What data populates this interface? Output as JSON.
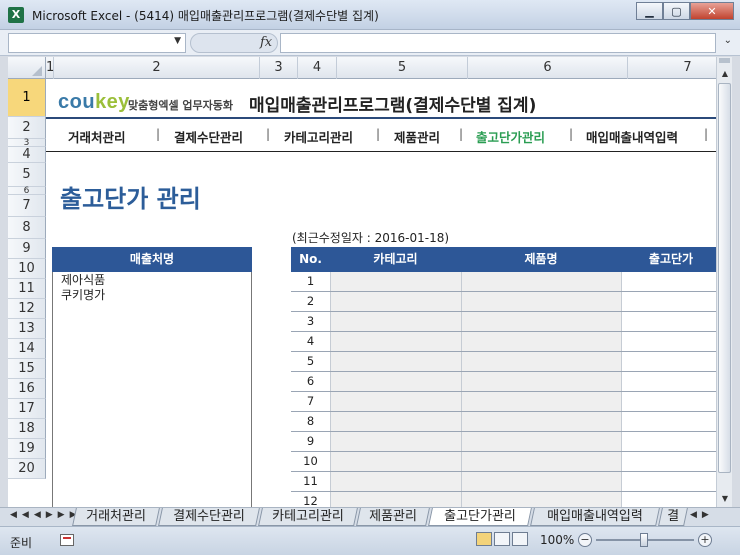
{
  "window": {
    "title": "Microsoft Excel - (5414) 매입매출관리프로그램(결제수단별 집계)",
    "app_icon": "X",
    "minimize": "▁",
    "maximize": "▢",
    "close": "✕"
  },
  "formula_bar": {
    "name_box": "",
    "fx_label": "fx",
    "formula": ""
  },
  "columns": [
    "1",
    "2",
    "3",
    "4",
    "5",
    "6",
    "7"
  ],
  "rows": [
    "1",
    "2",
    "3",
    "4",
    "5",
    "6",
    "7",
    "8",
    "9",
    "10",
    "11",
    "12",
    "13",
    "14",
    "15",
    "16",
    "17",
    "18",
    "19",
    "20"
  ],
  "header": {
    "brand": "cou",
    "brand_k": "key",
    "brand_sub": "맞춤형엑셀 업무자동화",
    "app_title": "매입매출관리프로그램(결제수단별 집계)"
  },
  "nav": {
    "items": [
      "거래처관리",
      "결제수단관리",
      "카테고리관리",
      "제품관리",
      "출고단가관리",
      "매입매출내역입력"
    ],
    "active_index": 4,
    "separator": "|"
  },
  "page": {
    "title": "출고단가 관리",
    "revision_date": "(최근수정일자 : 2016-01-18)"
  },
  "customer_panel": {
    "header": "매출처명",
    "items": [
      "제아식품",
      "쿠키명가"
    ]
  },
  "price_table": {
    "headers": [
      "No.",
      "카테고리",
      "제품명",
      "출고단가"
    ],
    "rows": [
      "1",
      "2",
      "3",
      "4",
      "5",
      "6",
      "7",
      "8",
      "9",
      "10",
      "11",
      "12"
    ]
  },
  "sheet_tabs": {
    "items": [
      "거래처관리",
      "결제수단관리",
      "카테고리관리",
      "제품관리",
      "출고단가관리",
      "매입매출내역입력",
      "결"
    ],
    "active_index": 4
  },
  "status_bar": {
    "ready": "준비",
    "zoom": "100%",
    "zoom_out": "−",
    "zoom_in": "+"
  },
  "colors": {
    "accent_blue": "#2d5797",
    "active_nav": "#2a9d52",
    "title_blue": "#2c5d99"
  }
}
